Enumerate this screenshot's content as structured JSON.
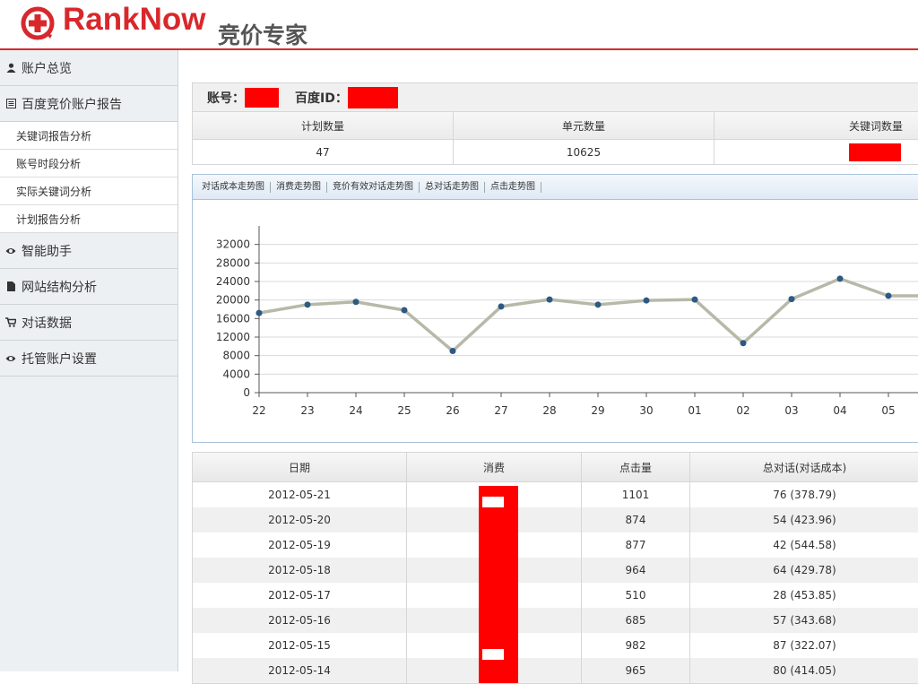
{
  "brand": {
    "name": "RankNow",
    "subtitle": "竞价专家",
    "accent": "#d8282c"
  },
  "sidebar": {
    "items": [
      {
        "label": "账户总览",
        "icon": "user-icon"
      },
      {
        "label": "百度竞价账户报告",
        "icon": "report-icon",
        "children": [
          "关键词报告分析",
          "账号时段分析",
          "实际关键词分析",
          "计划报告分析"
        ]
      },
      {
        "label": "智能助手",
        "icon": "eye-icon"
      },
      {
        "label": "网站结构分析",
        "icon": "file-icon"
      },
      {
        "label": "对话数据",
        "icon": "cart-icon"
      },
      {
        "label": "托管账户设置",
        "icon": "eye-icon"
      }
    ]
  },
  "account": {
    "account_label": "账号：",
    "baidu_id_label": "百度ID：",
    "columns": [
      "计划数量",
      "单元数量",
      "关键词数量"
    ],
    "values": [
      "47",
      "10625",
      ""
    ]
  },
  "chart_tabs": [
    "对话成本走势图",
    "消费走势图",
    "竞价有效对话走势图",
    "总对话走势图",
    "点击走势图"
  ],
  "chart_data": {
    "type": "line",
    "categories": [
      "22",
      "23",
      "24",
      "25",
      "26",
      "27",
      "28",
      "29",
      "30",
      "01",
      "02",
      "03",
      "04",
      "05"
    ],
    "series": [
      {
        "values": [
          17200,
          19000,
          19600,
          17800,
          9000,
          18600,
          20100,
          19000,
          19900,
          20100,
          10700,
          20200,
          24600,
          20900
        ]
      }
    ],
    "y_ticks": [
      0,
      4000,
      8000,
      12000,
      16000,
      20000,
      24000,
      28000,
      32000
    ],
    "ylim": [
      0,
      36000
    ],
    "grid": true,
    "line_color": "#b7b9a8",
    "point_color": "#2d5a84"
  },
  "table": {
    "headers": [
      "日期",
      "消费",
      "点击量",
      "总对话(对话成本)"
    ],
    "rows": [
      {
        "date": "2012-05-21",
        "cost": "",
        "clicks": "1101",
        "chats": "76 (378.79)"
      },
      {
        "date": "2012-05-20",
        "cost": "",
        "clicks": "874",
        "chats": "54 (423.96)"
      },
      {
        "date": "2012-05-19",
        "cost": "",
        "clicks": "877",
        "chats": "42 (544.58)"
      },
      {
        "date": "2012-05-18",
        "cost": "",
        "clicks": "964",
        "chats": "64 (429.78)"
      },
      {
        "date": "2012-05-17",
        "cost": "",
        "clicks": "510",
        "chats": "28 (453.85)"
      },
      {
        "date": "2012-05-16",
        "cost": "",
        "clicks": "685",
        "chats": "57 (343.68)"
      },
      {
        "date": "2012-05-15",
        "cost": "",
        "clicks": "982",
        "chats": "87 (322.07)"
      },
      {
        "date": "2012-05-14",
        "cost": "",
        "clicks": "965",
        "chats": "80 (414.05)"
      }
    ]
  }
}
